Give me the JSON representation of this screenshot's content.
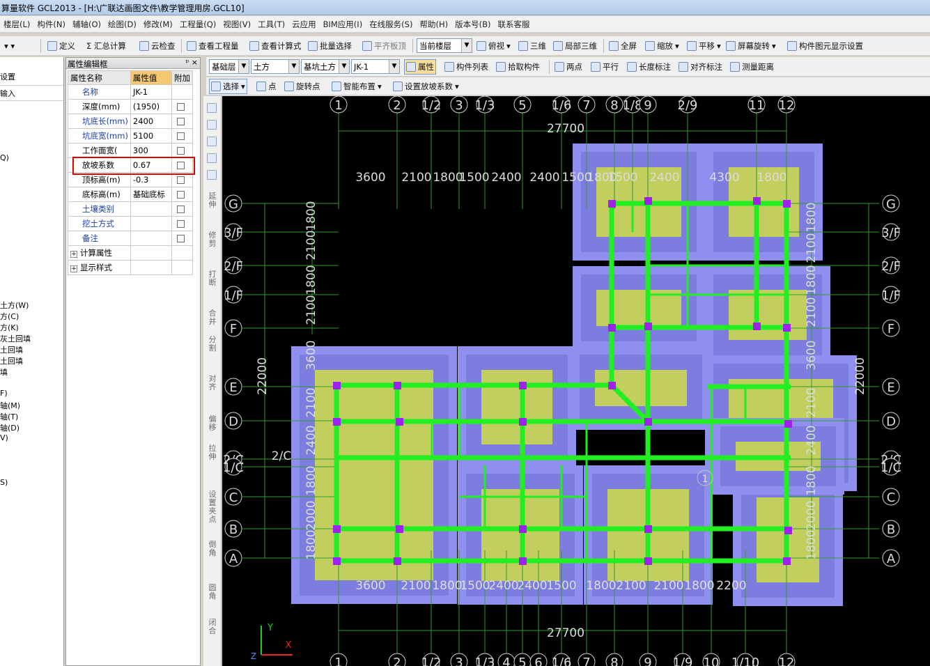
{
  "title": "算量软件 GCL2013 - [H:\\广联达画图文件\\教学管理用房.GCL10]",
  "menu": [
    "楼层(L)",
    "构件(N)",
    "辅轴(O)",
    "绘图(D)",
    "修改(M)",
    "工程量(Q)",
    "视图(V)",
    "工具(T)",
    "云应用",
    "BIM应用(I)",
    "在线服务(S)",
    "帮助(H)",
    "版本号(B)",
    "联系客服"
  ],
  "toolbar1": {
    "define": "定义",
    "summary": "Σ 汇总计算",
    "cloud_check": "云检查",
    "view_qty": "查看工程量",
    "view_formula": "查看计算式",
    "batch_select": "批量选择",
    "flatten": "平齐板顶",
    "current_floor": "当前楼层",
    "top_view": "俯视",
    "three_d": "三维",
    "local_3d": "局部三维",
    "fullscreen": "全屏",
    "zoom": "缩放",
    "pan": "平移",
    "rotate": "屏幕旋转",
    "display_setting": "构件图元显示设置"
  },
  "toolbar2": {
    "floor": "基础层",
    "type": "土方",
    "subtype": "基坑土方",
    "component": "JK-1",
    "properties": "属性",
    "list": "构件列表",
    "pick": "拾取构件",
    "two_points": "两点",
    "parallel": "平行",
    "length_dim": "长度标注",
    "align_dim": "对齐标注",
    "measure": "测量距离"
  },
  "toolbar3": {
    "select": "选择",
    "point": "点",
    "rotate_point": "旋转点",
    "smart_layout": "智能布置",
    "set_slope": "设置放坡系数"
  },
  "left_panel": {
    "items": [
      "设置",
      "输入",
      "Q)",
      "土方(W)",
      "方(C)",
      "方(K)",
      "灰土回填",
      "土回填",
      "土回填",
      "填",
      "F)",
      "轴(M)",
      "轴(T)",
      "轴(D)",
      "V)",
      "S)"
    ]
  },
  "prop_panel": {
    "title": "属性编辑框",
    "headers": [
      "属性名称",
      "属性值",
      "附加"
    ],
    "rows": [
      {
        "name": "名称",
        "value": "JK-1",
        "link": true,
        "check": false
      },
      {
        "name": "深度(mm)",
        "value": "(1950)",
        "link": false,
        "check": true
      },
      {
        "name": "坑底长(mm)",
        "value": "2400",
        "link": true,
        "check": true
      },
      {
        "name": "坑底宽(mm)",
        "value": "5100",
        "link": true,
        "check": true
      },
      {
        "name": "工作面宽(",
        "value": "300",
        "link": false,
        "check": true
      },
      {
        "name": "放坡系数",
        "value": "0.67",
        "link": false,
        "check": true
      },
      {
        "name": "顶标高(m)",
        "value": "-0.3",
        "link": false,
        "check": true
      },
      {
        "name": "底标高(m)",
        "value": "基础底标",
        "link": false,
        "check": true
      },
      {
        "name": "土壤类别",
        "value": "",
        "link": true,
        "check": true
      },
      {
        "name": "挖土方式",
        "value": "",
        "link": true,
        "check": true
      },
      {
        "name": "备注",
        "value": "",
        "link": true,
        "check": true
      },
      {
        "name": "计算属性",
        "value": "",
        "link": false,
        "check": false,
        "group": true
      },
      {
        "name": "显示样式",
        "value": "",
        "link": false,
        "check": false,
        "group": true
      }
    ]
  },
  "vtools": [
    "延伸",
    "修剪",
    "打断",
    "合并",
    "分割",
    "对齐",
    "偏移",
    "拉伸",
    "设置夹点",
    "倒角",
    "圆角",
    "闭合"
  ],
  "drawing": {
    "axes_top": [
      "1",
      "2",
      "1/2",
      "3",
      "1/3",
      "5",
      "1/6",
      "7",
      "8",
      "1/8",
      "9",
      "2/9",
      "11",
      "12"
    ],
    "axes_bottom": [
      "1",
      "2",
      "1/2",
      "3",
      "1/3",
      "4",
      "5",
      "6",
      "1/6",
      "7",
      "8",
      "9",
      "1/9",
      "10",
      "1/10",
      "12"
    ],
    "axes_rows": [
      "G",
      "3/F",
      "2/F",
      "1/F",
      "F",
      "E",
      "D",
      "2/C",
      "1/C",
      "C",
      "B",
      "A"
    ],
    "dim_total_top": "27700",
    "dim_total_bottom": "27700",
    "dim_total_left": "22000",
    "dim_total_right": "22000",
    "dims_top": [
      "3600",
      "2100",
      "1800",
      "1500",
      "2400",
      "2400",
      "1500",
      "1800",
      "1500",
      "2400",
      "4300",
      "1800"
    ],
    "dims_bottom": [
      "3600",
      "2100",
      "1800",
      "1500",
      "2400",
      "2400",
      "1500",
      "1800",
      "2100",
      "2100",
      "1800",
      "2200"
    ],
    "dims_left_upper": [
      "2100",
      "1800",
      "2100",
      "1800"
    ],
    "dims_left_lower": [
      "3600",
      "2100",
      "2400",
      "1800",
      "2000",
      "1800"
    ],
    "dims_right": [
      "1800",
      "2100",
      "1800",
      "2100",
      "3600",
      "2100",
      "2400",
      "1800",
      "2000",
      "1800"
    ],
    "misc_label": "2/C",
    "circle_label": "1",
    "ucs": {
      "x": "X",
      "y": "Y",
      "z": "Z"
    },
    "colors": {
      "pit_outer": "#8f8ff0",
      "pit_inner": "#c2cf5e",
      "beam": "#22ee22",
      "column": "#a020f0",
      "grid": "#2f9a2f"
    }
  }
}
